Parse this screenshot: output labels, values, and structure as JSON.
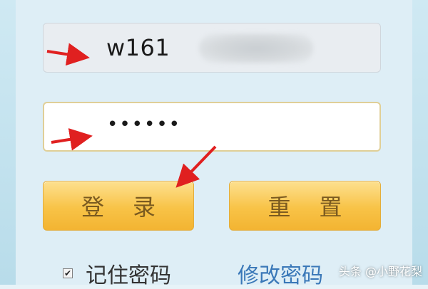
{
  "login_form": {
    "username_value": "w161",
    "password_value": "••••••",
    "login_button_label": "登录",
    "reset_button_label": "重置",
    "remember_checked": true,
    "remember_label": "记住密码",
    "modify_password_label": "修改密码"
  },
  "overlay": {
    "watermark": "头条 @小野花梨",
    "arrow_color": "#e02020"
  },
  "colors": {
    "button_gold": "#f8c347",
    "link_blue": "#3a78b8",
    "panel_bg": "#deeef6"
  }
}
